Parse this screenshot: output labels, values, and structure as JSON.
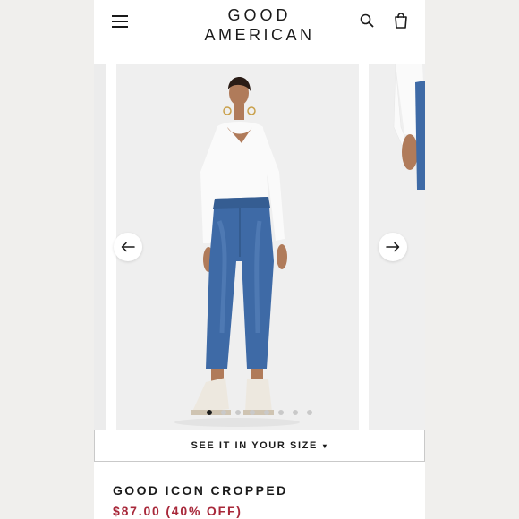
{
  "header": {
    "brand_line1": "GOOD",
    "brand_line2": "AMERICAN",
    "icons": [
      "hamburger-menu-icon",
      "search-icon",
      "shopping-bag-icon"
    ]
  },
  "carousel": {
    "dots_total": 8,
    "active_dot": 1,
    "arrows": [
      "arrow-left-icon",
      "arrow-right-icon"
    ]
  },
  "size_button": {
    "label": "SEE IT IN YOUR SIZE",
    "caret": "▾"
  },
  "product": {
    "title": "GOOD ICON CROPPED",
    "price": "$87.00",
    "discount": "(40% OFF)"
  },
  "colors": {
    "accent": "#a8283a",
    "text": "#1a1a1a",
    "background": "#f0efed",
    "denim": "#3e6aa6"
  }
}
